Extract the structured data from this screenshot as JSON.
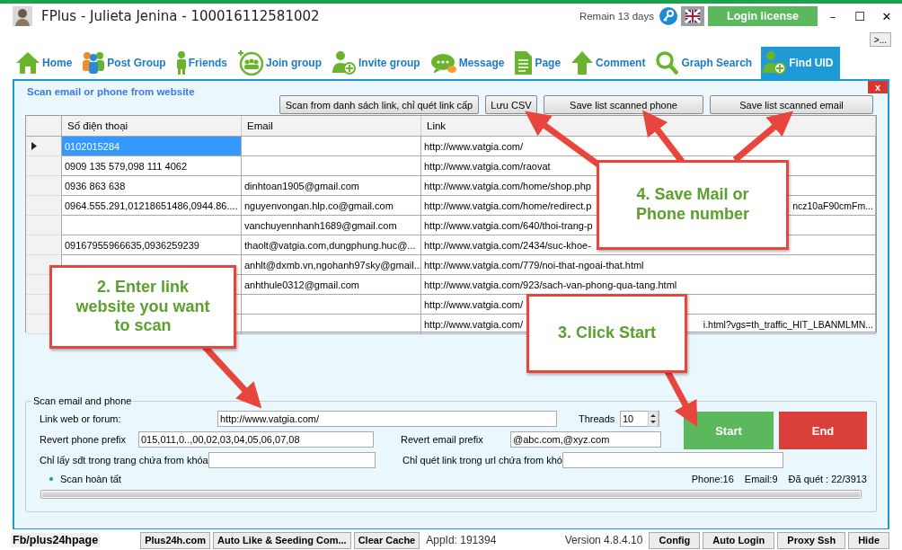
{
  "window": {
    "title": "FPlus - Julieta Jenina - 100016112581002",
    "remain": "Remain 13 days",
    "login_button": "Login license",
    "minimize": "–",
    "maximize": "☐",
    "close": "✕",
    "more_button": ">..."
  },
  "tabs": [
    {
      "label": "Home",
      "kind": "house",
      "selected": false
    },
    {
      "label": "Post Group",
      "kind": "people",
      "selected": false
    },
    {
      "label": "Friends",
      "kind": "person",
      "selected": false
    },
    {
      "label": "Join group",
      "kind": "circle-group",
      "selected": false
    },
    {
      "label": "Invite group",
      "kind": "person-plus",
      "selected": false
    },
    {
      "label": "Message",
      "kind": "chat",
      "selected": false
    },
    {
      "label": "Page",
      "kind": "document",
      "selected": false
    },
    {
      "label": "Comment",
      "kind": "up-arrow",
      "selected": false
    },
    {
      "label": "Graph Search",
      "kind": "magnifier",
      "selected": false
    },
    {
      "label": "Find UID",
      "kind": "person-plus",
      "selected": true
    }
  ],
  "panel": {
    "title": "Scan email or phone from website",
    "close": "x",
    "buttons": [
      "Scan from danh sách link, chỉ quét link cấp",
      "Lưu CSV",
      "Save list scanned phone",
      "Save list scanned email"
    ]
  },
  "table": {
    "columns": [
      "Số điện thoại",
      "Email",
      "Link"
    ],
    "rows": [
      {
        "selected": true,
        "phone": "0102015284",
        "email": "",
        "link": "http://www.vatgia.com/"
      },
      {
        "selected": false,
        "phone": "0909 135 579,098 111 4062",
        "email": "",
        "link": "http://www.vatgia.com/raovat"
      },
      {
        "selected": false,
        "phone": "0936 863 638",
        "email": "dinhtoan1905@gmail.com",
        "link": "http://www.vatgia.com/home/shop.php"
      },
      {
        "selected": false,
        "phone": "0964.555.291,01218651486,0944.86....",
        "email": "nguyenvongan.hlp.co@gmail.com",
        "link": "http://www.vatgia.com/home/redirect.p",
        "link_tail": "ncz10aF90cmFm..."
      },
      {
        "selected": false,
        "phone": "",
        "email": "vanchuyennhanh1689@gmail.com",
        "link": "http://www.vatgia.com/640/thoi-trang-p"
      },
      {
        "selected": false,
        "phone": "09167955966635,0936259239",
        "email": "thaolt@vatgia.com,dungphung.huc@...",
        "link": "http://www.vatgia.com/2434/suc-khoe-"
      },
      {
        "selected": false,
        "phone": "",
        "email": "anhlt@dxmb.vn,ngohanh97sky@gmail...",
        "link": "http://www.vatgia.com/779/noi-that-ngoai-that.html"
      },
      {
        "selected": false,
        "phone": "",
        "email": "anhthule0312@gmail.com",
        "link": "http://www.vatgia.com/923/sach-van-phong-qua-tang.html"
      },
      {
        "selected": false,
        "phone": "",
        "email": "",
        "link": "http://www.vatgia.com/"
      },
      {
        "selected": false,
        "phone": "",
        "email": "",
        "link": "http://www.vatgia.com/",
        "link_tail": "i.html?vgs=th_traffic_HIT_LBANMLMN..."
      }
    ]
  },
  "form": {
    "legend": "Scan email and phone",
    "link_label": "Link web or forum:",
    "link_value": "http://www.vatgia.com/",
    "threads_label": "Threads",
    "threads_value": "10",
    "phone_prefix_label": "Revert phone prefix",
    "phone_prefix_value": "015,011,0..,00,02,03,04,05,06,07,08",
    "email_prefix_label": "Revert email prefix",
    "email_prefix_value": "@abc.com,@xyz.com",
    "phone_keyword_label": "Chỉ lấy sđt trong trang chứa from khóa:",
    "link_keyword_label": "Chỉ quét link trong url chứa from khó",
    "start": "Start",
    "end": "End",
    "status": "Scan hoàn tất",
    "progress": {
      "level": 1
    },
    "phone_count": "Phone:16",
    "email_count": "Email:9",
    "scanned": "Đã quét : 22/3913"
  },
  "callouts": [
    {
      "text": "4. Save Mail or Phone number"
    },
    {
      "text": "2. Enter link website you want to scan"
    },
    {
      "text": "3. Click Start"
    }
  ],
  "status_bar": {
    "page": "Fb/plus24hpage",
    "buttons_left": [
      "Plus24h.com",
      "Auto Like & Seeding Com...",
      "Clear Cache"
    ],
    "app_id": "AppId: 191394",
    "version": "Version 4.8.4.10",
    "buttons_right": [
      "Config",
      "Auto Login",
      "Proxy Ssh",
      "Hide"
    ]
  }
}
